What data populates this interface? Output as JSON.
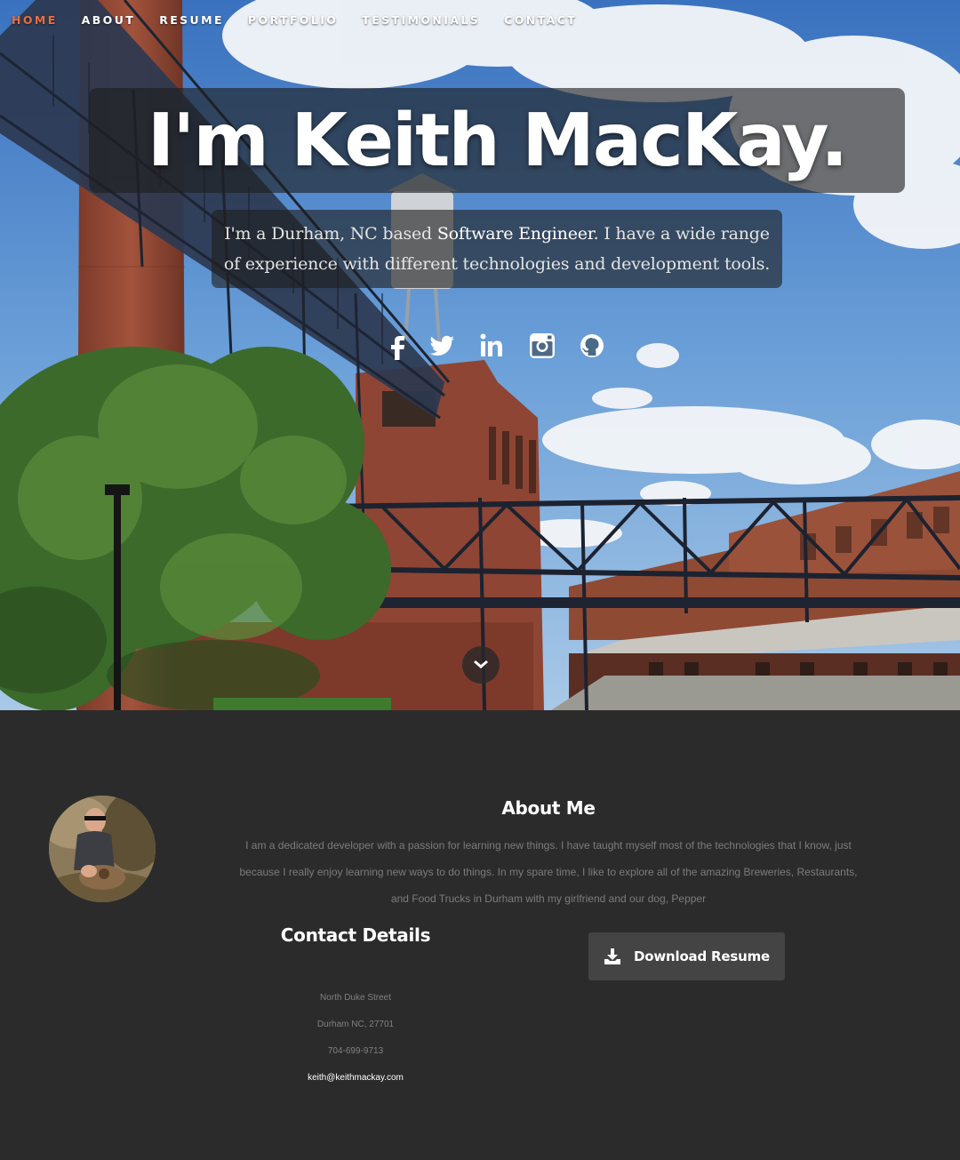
{
  "nav": {
    "items": [
      {
        "label": "HOME",
        "active": true
      },
      {
        "label": "ABOUT",
        "active": false
      },
      {
        "label": "RESUME",
        "active": false
      },
      {
        "label": "PORTFOLIO",
        "active": false
      },
      {
        "label": "TESTIMONIALS",
        "active": false
      },
      {
        "label": "CONTACT",
        "active": false
      }
    ],
    "active_color": "#ec6d3e"
  },
  "hero": {
    "title": "I'm Keith MacKay.",
    "subtitle_prefix": "I'm a Durham, NC based ",
    "subtitle_highlight": "Software Engineer",
    "subtitle_suffix": ". I have a wide range of experience with different technologies and development tools.",
    "social_icons": [
      "facebook-icon",
      "twitter-icon",
      "linkedin-icon",
      "instagram-icon",
      "github-icon"
    ],
    "scroll_icon": "chevron-down-icon"
  },
  "about": {
    "title": "About Me",
    "text": "I am a dedicated developer with a passion for learning new things. I have taught myself most of the technologies that I know, just because I really enjoy learning new ways to do things. In my spare time, I like to explore all of the amazing Breweries, Restaurants, and Food Trucks in Durham with my girlfriend and our dog, Pepper",
    "contact_title": "Contact Details",
    "contact": {
      "street": "North Duke Street",
      "city": "Durham NC, 27701",
      "phone": "704-699-9713",
      "email": "keith@keithmackay.com"
    },
    "resume_button": "Download Resume",
    "resume_icon": "download-icon"
  },
  "colors": {
    "background": "#2b2b2b",
    "accent": "#ec6d3e",
    "button": "#444444"
  }
}
